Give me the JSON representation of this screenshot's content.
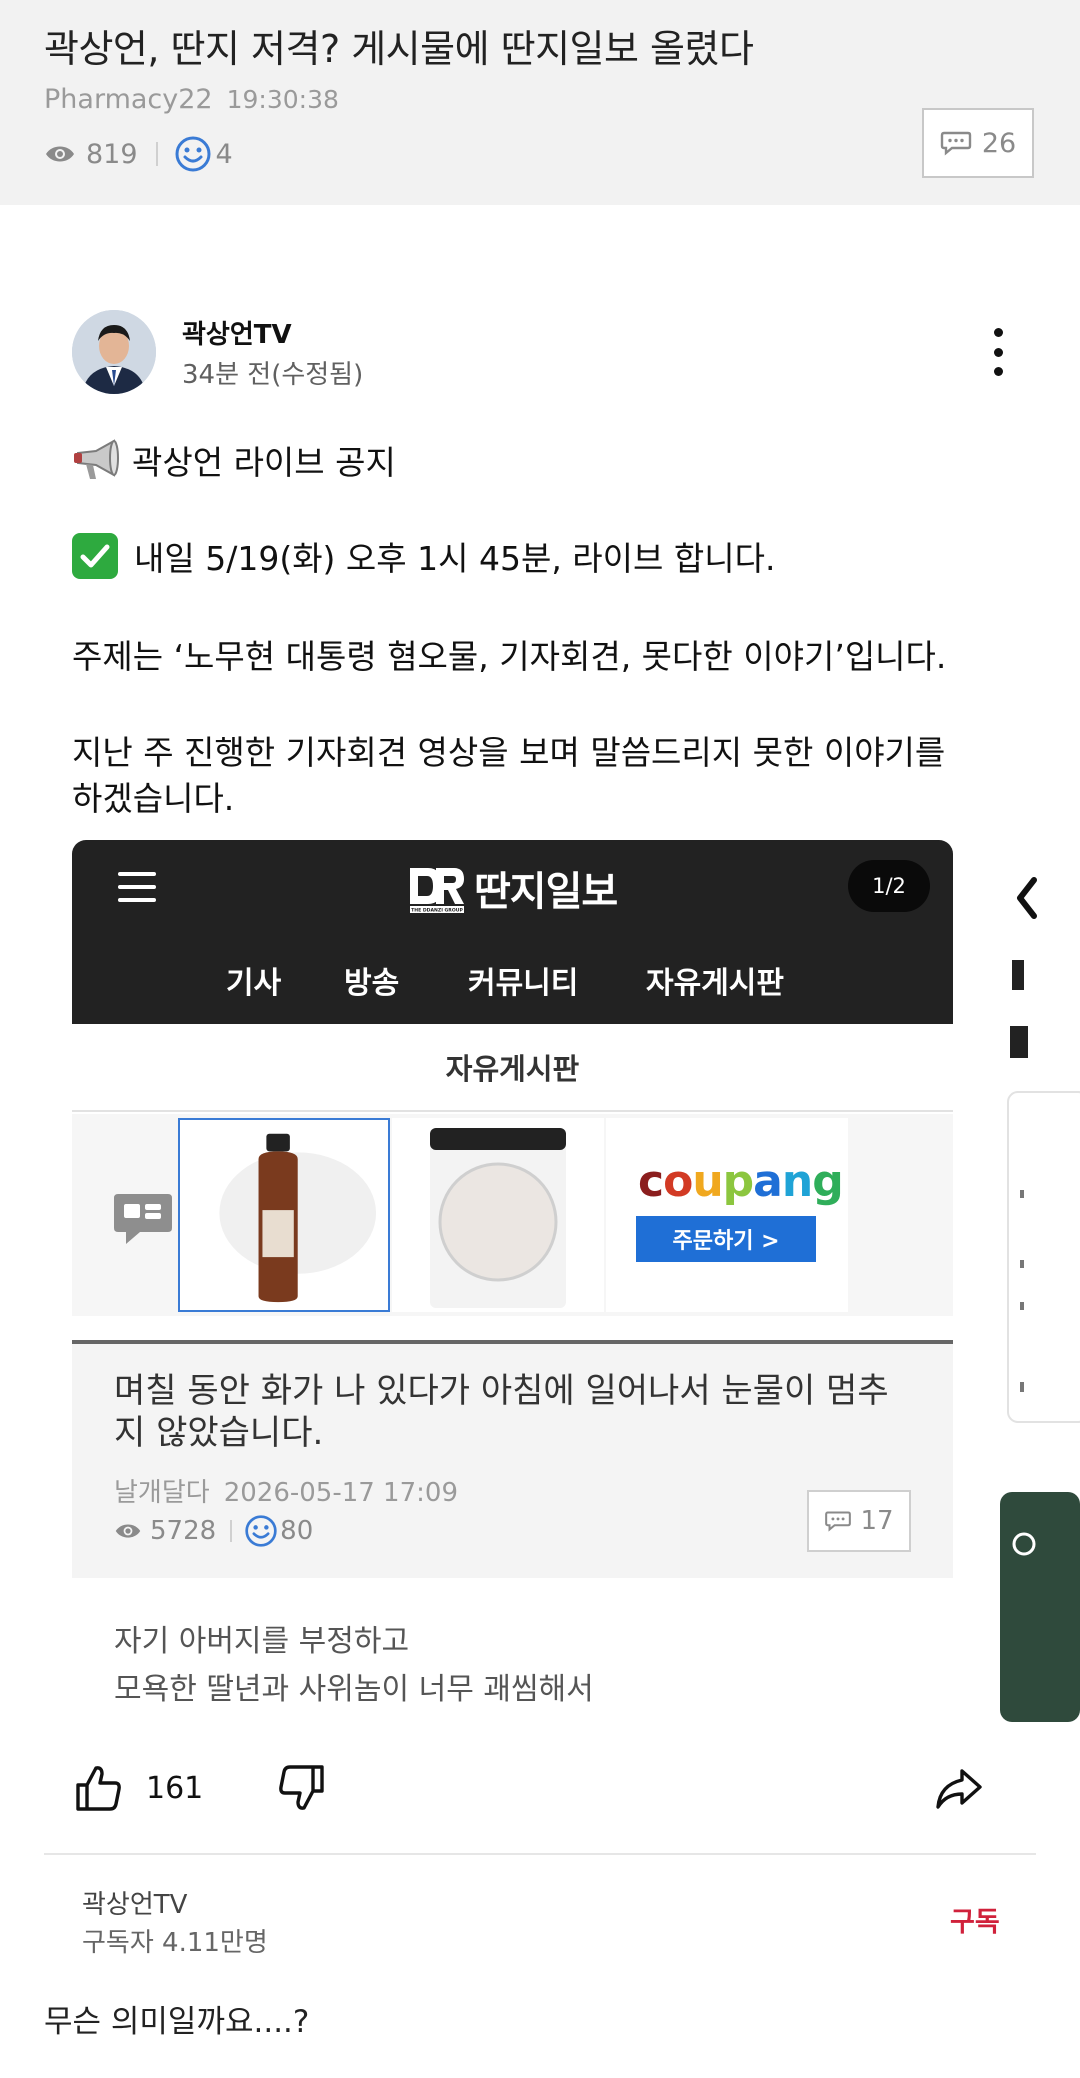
{
  "post": {
    "title": "곽상언, 딴지 저격? 게시물에 딴지일보 올렸다",
    "author": "Pharmacy22",
    "time": "19:30:38",
    "views": "819",
    "likes": "4",
    "comments": "26"
  },
  "community_post": {
    "channel_name": "곽상언TV",
    "posted_time": "34분 전(수정됨)",
    "line1": "곽상언 라이브 공지",
    "line2": "내일 5/19(화) 오후 1시 45분, 라이브 합니다.",
    "line3": "주제는 ‘노무현 대통령 혐오물, 기자회견, 못다한 이야기’입니다.",
    "line4a": "지난 주 진행한 기자회견 영상을 보며 말씀드리지 못한 이야기를",
    "line4b": "하겠습니다.",
    "like_count": "161",
    "subscriber_name": "곽상언TV",
    "subscriber_count": "구독자 4.11만명",
    "subscribe_label": "구독"
  },
  "embedded_screenshot": {
    "site_name": "딴지일보",
    "logo_tagline": "THE DDANZI GROUP",
    "page_indicator": "1/2",
    "nav": [
      "기사",
      "방송",
      "커뮤니티",
      "자유게시판"
    ],
    "board_title": "자유게시판",
    "ad": {
      "brand": "coupang",
      "button": "주문하기 >"
    },
    "article": {
      "title": "며칠 동안 화가 나 있다가 아침에 일어나서 눈물이 멈추지 않았습니다.",
      "author": "날개달다",
      "date": "2026-05-17 17:09",
      "views": "5728",
      "likes": "80",
      "comments": "17",
      "body_line1": "자기 아버지를 부정하고",
      "body_line2": "모욕한 딸년과 사위놈이 너무 괘씸해서"
    }
  },
  "footer_comment": "무슨 의미일까요....?",
  "colors": {
    "header_bg": "#f2f2f2",
    "ddanzi_bar": "#222222",
    "subscribe_red": "#d0213b",
    "check_green": "#2eaa3f",
    "coupang_blue": "#1f6fd6"
  },
  "icons": [
    "eye-icon",
    "smile-icon",
    "comment-icon",
    "kebab-menu-icon",
    "megaphone-icon",
    "check-icon",
    "hamburger-icon",
    "chat-bubble-icon",
    "thumbs-up-icon",
    "thumbs-down-icon",
    "share-icon",
    "chevron-left-icon"
  ]
}
